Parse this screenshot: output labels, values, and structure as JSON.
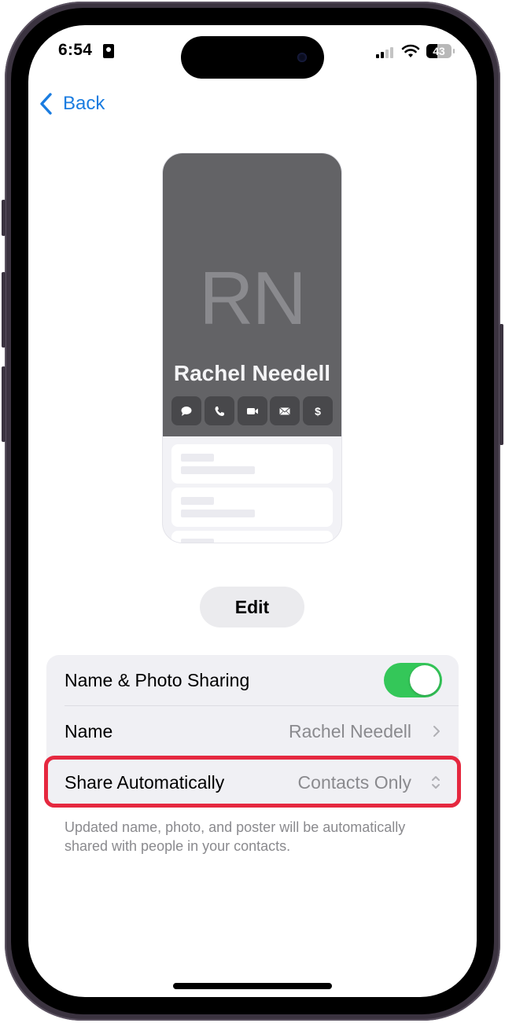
{
  "status_bar": {
    "time": "6:54",
    "battery_percent": "43",
    "battery_level": 0.43,
    "signal_bars_active": 2,
    "signal_bars_total": 4
  },
  "nav": {
    "back_label": "Back"
  },
  "poster": {
    "monogram": "RN",
    "name": "Rachel Needell",
    "actions": [
      {
        "icon": "message-icon"
      },
      {
        "icon": "phone-icon"
      },
      {
        "icon": "video-icon"
      },
      {
        "icon": "mail-icon"
      },
      {
        "icon": "dollar-icon"
      }
    ]
  },
  "edit_button": {
    "label": "Edit"
  },
  "settings": {
    "rows": [
      {
        "label": "Name & Photo Sharing",
        "toggle_on": true
      },
      {
        "label": "Name",
        "value": "Rachel Needell"
      },
      {
        "label": "Share Automatically",
        "value": "Contacts Only"
      }
    ],
    "footer": "Updated name, photo, and poster will be automatically shared with people in your contacts."
  },
  "colors": {
    "accent": "#1a7ce0",
    "toggle_on": "#34c759",
    "highlight": "#e5283f"
  }
}
